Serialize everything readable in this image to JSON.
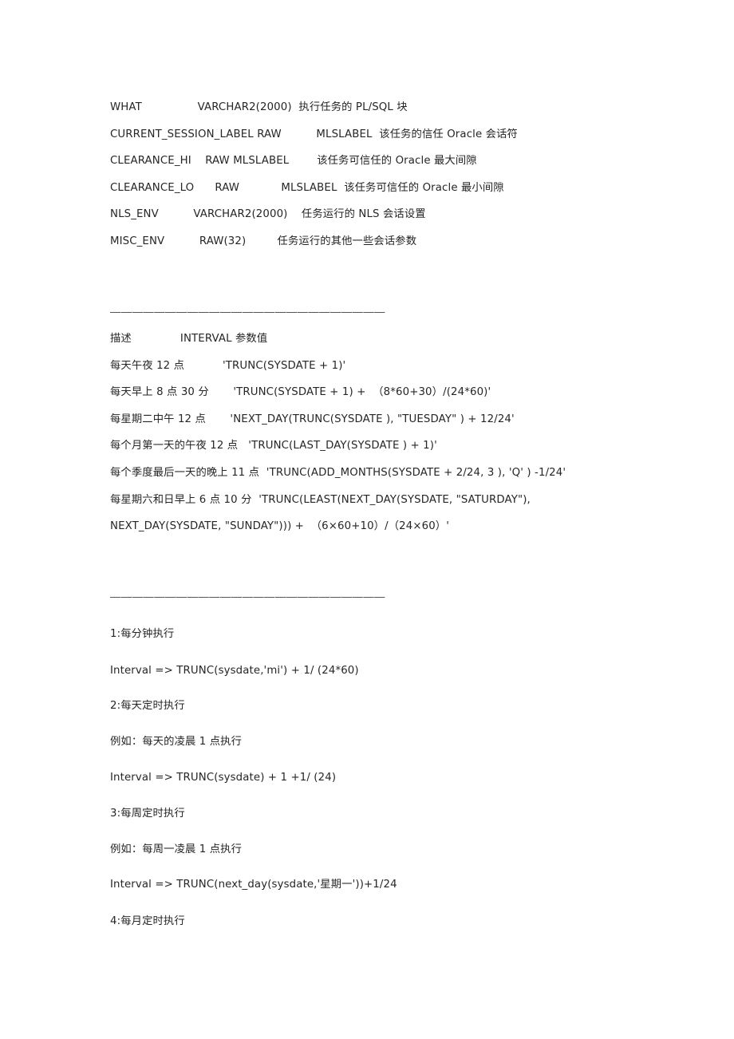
{
  "document": {
    "background_color": "#ffffff",
    "text_color": "#262626",
    "divider_glyph_row": "—————————————————————————"
  },
  "column_definitions": {
    "section_name": "job-column-definitions",
    "rows": [
      "WHAT                VARCHAR2(2000)  执行任务的 PL/SQL 块",
      "CURRENT_SESSION_LABEL RAW          MLSLABEL  该任务的信任 Oracle 会话符",
      "CLEARANCE_HI    RAW MLSLABEL        该任务可信任的 Oracle 最大间隙",
      "CLEARANCE_LO      RAW            MLSLABEL  该任务可信任的 Oracle 最小间隙",
      "NLS_ENV          VARCHAR2(2000)    任务运行的 NLS 会话设置",
      "MISC_ENV          RAW(32)         任务运行的其他一些会话参数"
    ]
  },
  "interval_table": {
    "section_name": "interval-parameter-table",
    "header": "描述              INTERVAL 参数值",
    "rows": [
      "每天午夜 12 点           'TRUNC(SYSDATE + 1)'",
      "每天早上 8 点 30 分       'TRUNC(SYSDATE + 1) +  （8*60+30）/(24*60)'",
      "每星期二中午 12 点       'NEXT_DAY(TRUNC(SYSDATE ), \"TUESDAY\" ) + 12/24'",
      "每个月第一天的午夜 12 点   'TRUNC(LAST_DAY(SYSDATE ) + 1)'",
      "每个季度最后一天的晚上 11 点  'TRUNC(ADD_MONTHS(SYSDATE + 2/24, 3 ), 'Q' ) -1/24'",
      "每星期六和日早上 6 点 10 分  'TRUNC(LEAST(NEXT_DAY(SYSDATE, \"SATURDAY\"),",
      "NEXT_DAY(SYSDATE, \"SUNDAY\"))) +  （6×60+10）/（24×60）'"
    ]
  },
  "examples": {
    "section_name": "scheduling-examples",
    "lines": [
      "1:每分钟执行",
      "Interval => TRUNC(sysdate,'mi') + 1/ (24*60)",
      "2:每天定时执行",
      "例如：每天的凌晨 1 点执行",
      "Interval => TRUNC(sysdate) + 1 +1/ (24)",
      "3:每周定时执行",
      "例如：每周一凌晨 1 点执行",
      "Interval => TRUNC(next_day(sysdate,'星期一'))+1/24",
      "4:每月定时执行"
    ]
  }
}
